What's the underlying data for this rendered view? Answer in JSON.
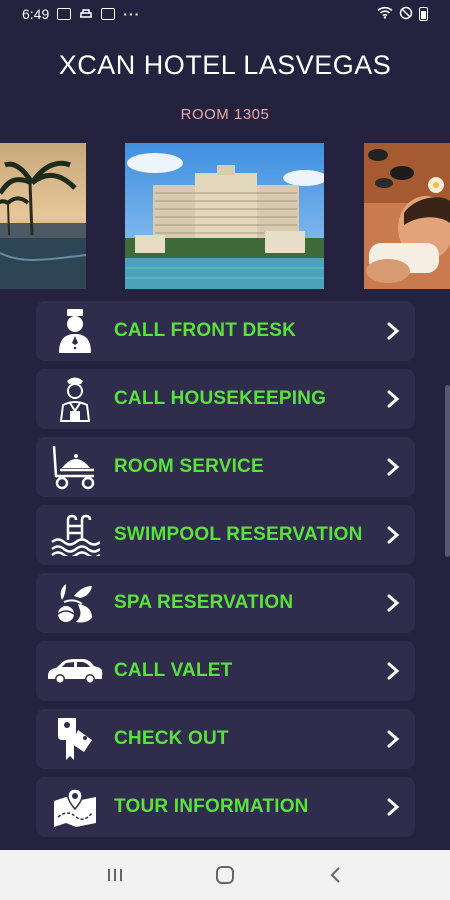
{
  "status_bar": {
    "time": "6:49",
    "more": "···"
  },
  "header": {
    "title": "XCAN HOTEL LASVEGAS",
    "room": "ROOM 1305"
  },
  "carousel": {
    "slides": [
      {
        "icon": "pool-resort-image"
      },
      {
        "icon": "bellagio-hotel-image"
      },
      {
        "icon": "spa-massage-image"
      }
    ]
  },
  "menu": {
    "items": [
      {
        "label": "CALL FRONT DESK",
        "icon": "bellboy-icon"
      },
      {
        "label": "CALL HOUSEKEEPING",
        "icon": "housekeeper-icon"
      },
      {
        "label": "ROOM SERVICE",
        "icon": "room-service-cart-icon"
      },
      {
        "label": "SWIMPOOL RESERVATION",
        "icon": "swimming-pool-icon"
      },
      {
        "label": "SPA RESERVATION",
        "icon": "spa-icon"
      },
      {
        "label": "CALL VALET",
        "icon": "car-icon"
      },
      {
        "label": "CHECK OUT",
        "icon": "key-tag-icon"
      },
      {
        "label": "TOUR INFORMATION",
        "icon": "map-pin-icon"
      }
    ]
  },
  "colors": {
    "background": "#24223f",
    "card": "#302d4c",
    "accent": "#58e23b",
    "room": "#e9a9a9"
  }
}
